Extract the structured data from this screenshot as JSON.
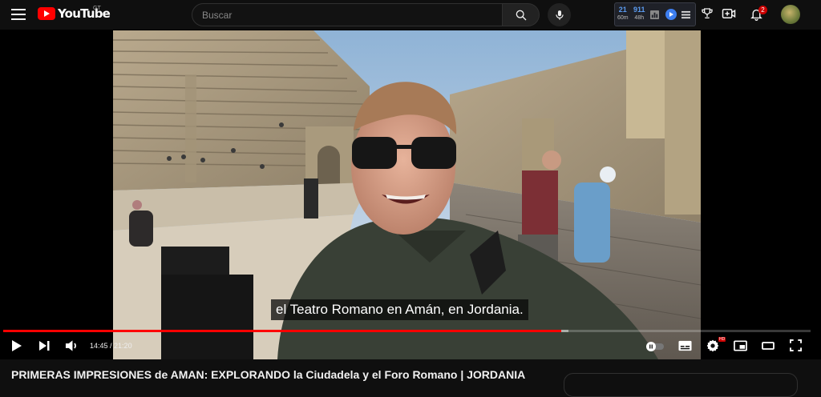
{
  "header": {
    "logo_text": "YouTube",
    "region": "GT",
    "search_placeholder": "Buscar",
    "icons": [
      "menu-icon",
      "search-icon",
      "mic-icon",
      "create-icon",
      "notifications-icon"
    ],
    "notification_count": "2"
  },
  "extension": {
    "stat1_value": "21",
    "stat1_unit": "60m",
    "stat2_value": "911",
    "stat2_unit": "48h"
  },
  "player": {
    "subtitle": "el Teatro Romano en Amán, en Jordania.",
    "current_time": "14:45",
    "separator": " / ",
    "duration": "21:20",
    "played_fraction": 0.6914,
    "buffered_fraction": 0.7,
    "quality_badge": "HD",
    "accent": "#ff0000"
  },
  "video": {
    "title": "PRIMERAS IMPRESIONES de AMAN: EXPLORANDO la Ciudadela y el Foro Romano | JORDANIA"
  }
}
